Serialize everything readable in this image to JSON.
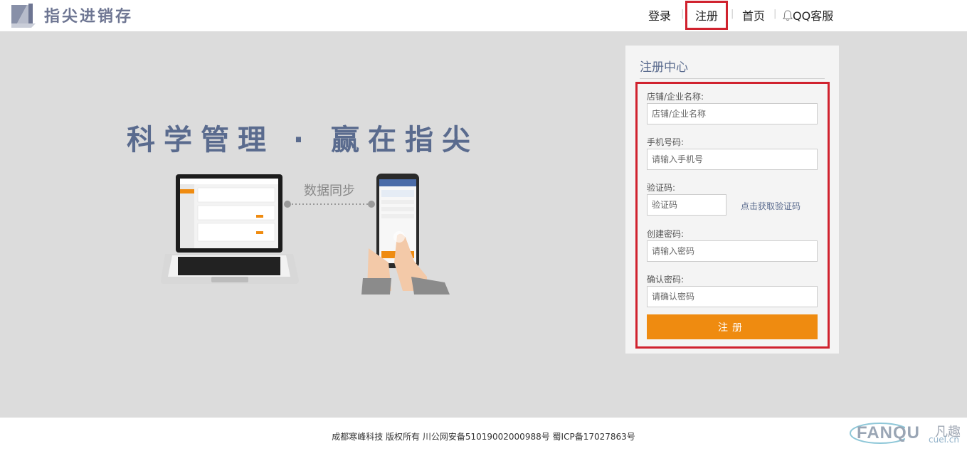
{
  "header": {
    "brand": "指尖进销存",
    "nav": {
      "login": "登录",
      "register": "注册",
      "home": "首页",
      "qq": "QQ客服",
      "separator": "|"
    }
  },
  "hero": {
    "slogan": "科学管理 · 赢在指尖",
    "sync_label": "数据同步"
  },
  "register": {
    "title": "注册中心",
    "fields": {
      "shop": {
        "label": "店铺/企业名称:",
        "placeholder": "店铺/企业名称"
      },
      "phone": {
        "label": "手机号码:",
        "placeholder": "请输入手机号"
      },
      "code": {
        "label": "验证码:",
        "placeholder": "验证码",
        "action": "点击获取验证码"
      },
      "password": {
        "label": "创建密码:",
        "placeholder": "请输入密码"
      },
      "confirm": {
        "label": "确认密码:",
        "placeholder": "请确认密码"
      }
    },
    "submit": "注册"
  },
  "footer": {
    "copyright": "成都寒峰科技 版权所有  川公网安备51019002000988号 蜀ICP备17027863号",
    "watermark": {
      "en": "FANQU",
      "cn": "凡趣",
      "url": "cuel.cn"
    }
  },
  "colors": {
    "accent": "#ef8b10",
    "highlight": "#d0222e",
    "brand": "#5a6b8e",
    "band": "#dcdcdc"
  }
}
